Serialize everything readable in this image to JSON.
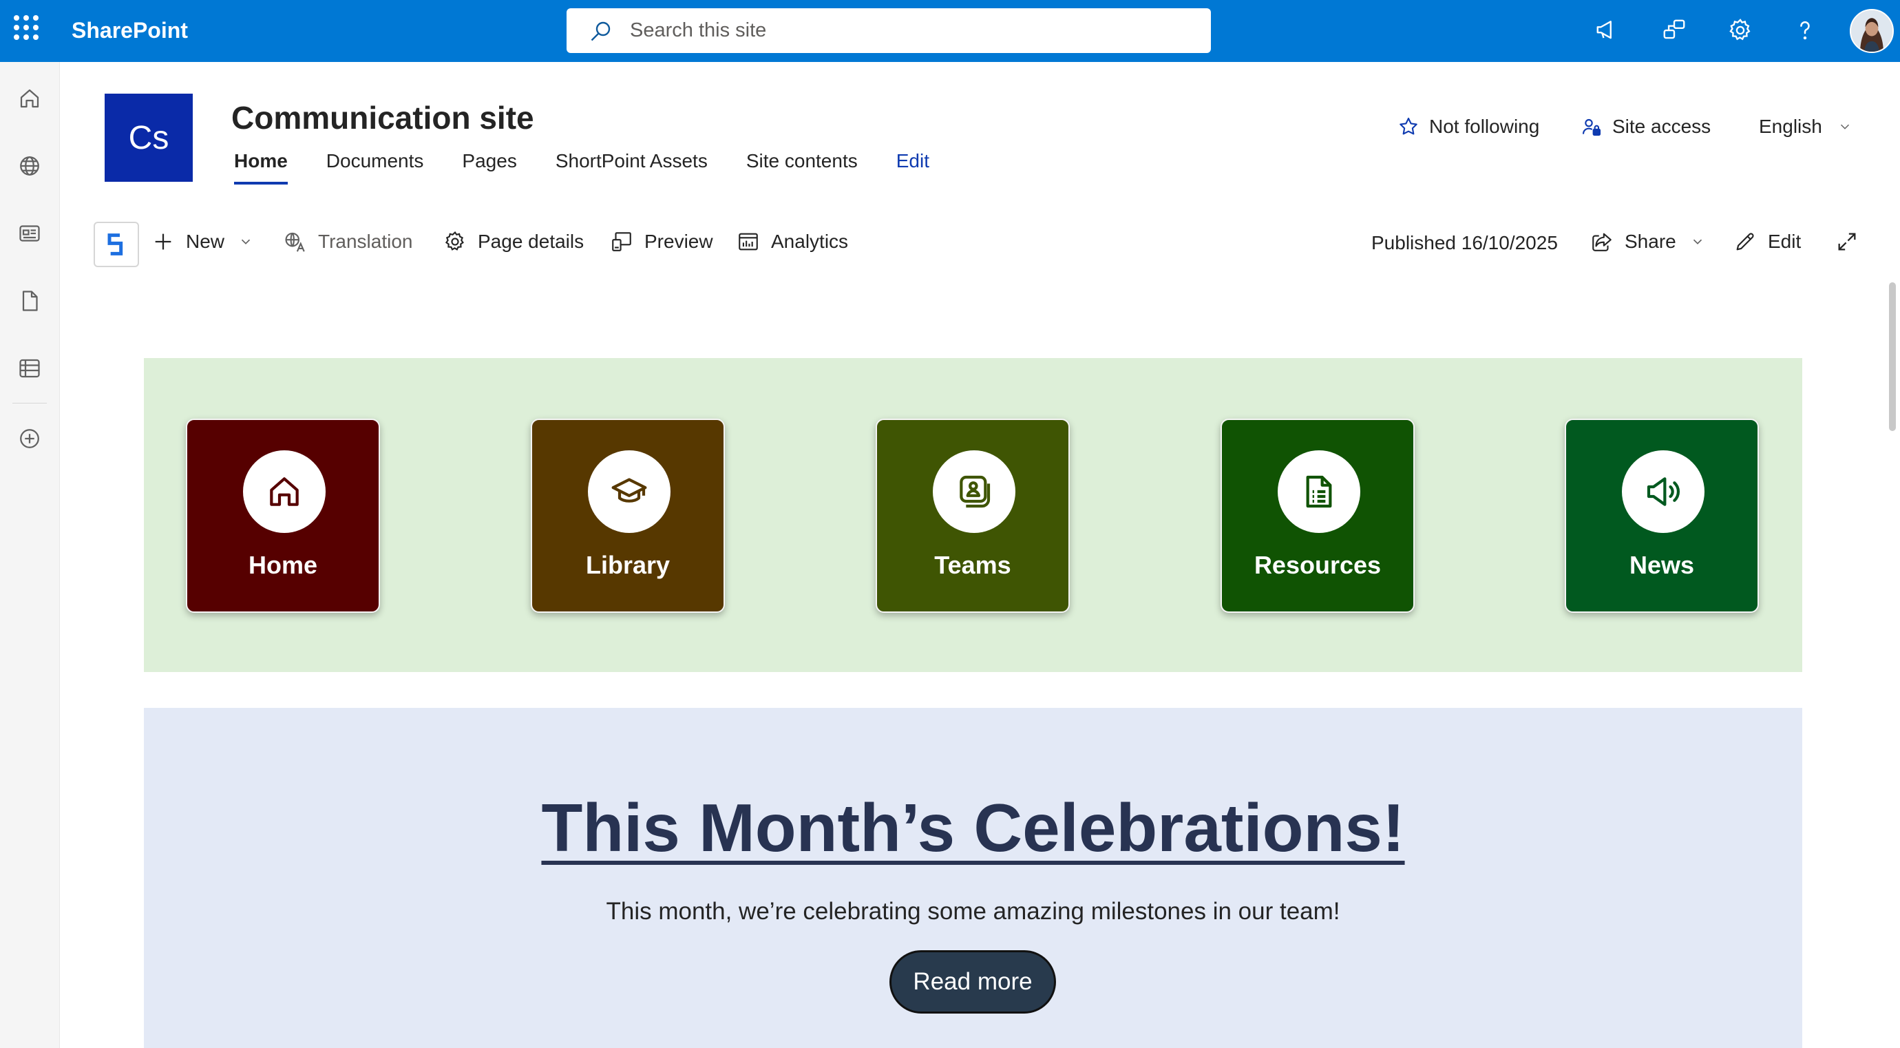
{
  "suitebar": {
    "app_name": "SharePoint",
    "search_placeholder": "Search this site",
    "icons": [
      "waffle-icon",
      "megaphone-icon",
      "feedback-icon",
      "gear-icon",
      "help-icon"
    ]
  },
  "leftrail": {
    "icons": [
      "home-icon",
      "globe-icon",
      "news-icon",
      "file-icon",
      "list-icon",
      "add-icon"
    ]
  },
  "site": {
    "logo_initials": "Cs",
    "title": "Communication site",
    "nav": [
      "Home",
      "Documents",
      "Pages",
      "ShortPoint Assets",
      "Site contents"
    ],
    "nav_edit": "Edit",
    "follow_label": "Not following",
    "site_access_label": "Site access",
    "language_label": "English"
  },
  "commandbar": {
    "new_label": "New",
    "translation_label": "Translation",
    "page_details_label": "Page details",
    "preview_label": "Preview",
    "analytics_label": "Analytics",
    "published_label": "Published 16/10/2025",
    "share_label": "Share",
    "edit_label": "Edit"
  },
  "quicklinks": [
    {
      "label": "Home",
      "color": "#560000",
      "icon": "home-icon"
    },
    {
      "label": "Library",
      "color": "#573800",
      "icon": "graduation-cap-icon"
    },
    {
      "label": "Teams",
      "color": "#3f5503",
      "icon": "people-card-icon"
    },
    {
      "label": "Resources",
      "color": "#105303",
      "icon": "document-icon"
    },
    {
      "label": "News",
      "color": "#01591f",
      "icon": "megaphone-icon"
    }
  ],
  "quicklinks_bg": "#ddefd8",
  "celebrations": {
    "title": "This Month’s Celebrations!",
    "text": "This month, we’re celebrating some amazing milestones in our team!",
    "button_label": "Read more",
    "bg": "#e3e9f6"
  }
}
